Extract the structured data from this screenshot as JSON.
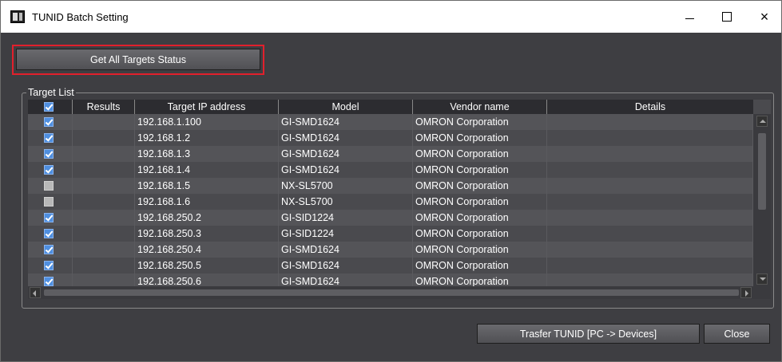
{
  "window": {
    "title": "TUNID Batch Setting"
  },
  "window_controls": {
    "minimize": "minimize",
    "maximize": "maximize",
    "close": "×"
  },
  "toolbar": {
    "get_status_label": "Get All Targets Status"
  },
  "target_list": {
    "label": "Target List",
    "select_all_checked": true,
    "columns": [
      "Results",
      "Target IP address",
      "Model",
      "Vendor name",
      "Details"
    ],
    "rows": [
      {
        "checked": true,
        "result": "",
        "ip": "192.168.1.100",
        "model": "GI-SMD1624",
        "vendor": "OMRON Corporation",
        "details": ""
      },
      {
        "checked": true,
        "result": "",
        "ip": "192.168.1.2",
        "model": "GI-SMD1624",
        "vendor": "OMRON Corporation",
        "details": ""
      },
      {
        "checked": true,
        "result": "",
        "ip": "192.168.1.3",
        "model": "GI-SMD1624",
        "vendor": "OMRON Corporation",
        "details": ""
      },
      {
        "checked": true,
        "result": "",
        "ip": "192.168.1.4",
        "model": "GI-SMD1624",
        "vendor": "OMRON Corporation",
        "details": ""
      },
      {
        "checked": false,
        "result": "",
        "ip": "192.168.1.5",
        "model": "NX-SL5700",
        "vendor": "OMRON Corporation",
        "details": ""
      },
      {
        "checked": false,
        "result": "",
        "ip": "192.168.1.6",
        "model": "NX-SL5700",
        "vendor": "OMRON Corporation",
        "details": ""
      },
      {
        "checked": true,
        "result": "",
        "ip": "192.168.250.2",
        "model": "GI-SID1224",
        "vendor": "OMRON Corporation",
        "details": ""
      },
      {
        "checked": true,
        "result": "",
        "ip": "192.168.250.3",
        "model": "GI-SID1224",
        "vendor": "OMRON Corporation",
        "details": ""
      },
      {
        "checked": true,
        "result": "",
        "ip": "192.168.250.4",
        "model": "GI-SMD1624",
        "vendor": "OMRON Corporation",
        "details": ""
      },
      {
        "checked": true,
        "result": "",
        "ip": "192.168.250.5",
        "model": "GI-SMD1624",
        "vendor": "OMRON Corporation",
        "details": ""
      },
      {
        "checked": true,
        "result": "",
        "ip": "192.168.250.6",
        "model": "GI-SMD1624",
        "vendor": "OMRON Corporation",
        "details": ""
      }
    ]
  },
  "footer": {
    "transfer_label": "Trasfer TUNID [PC -> Devices]",
    "close_label": "Close"
  },
  "colors": {
    "highlight": "#e2202c",
    "checkbox_checked": "#4f8fe0",
    "background": "#3e3e42"
  }
}
